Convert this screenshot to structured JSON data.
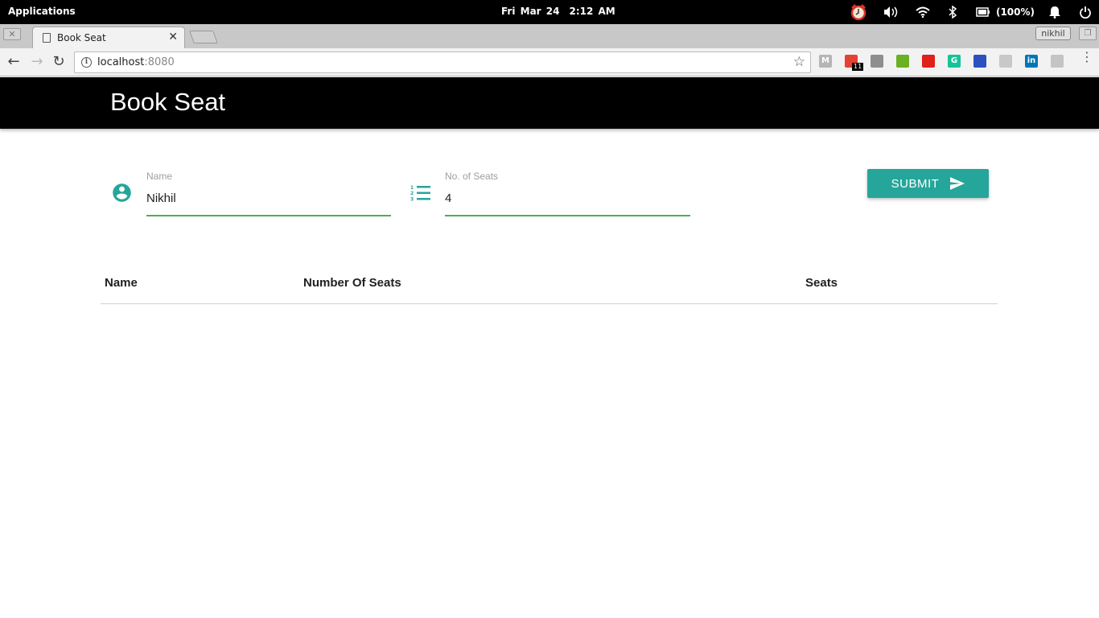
{
  "os": {
    "apps_label": "Applications",
    "date": "Fri Mar 24",
    "time": "2:12 AM",
    "battery_text": "(100%)",
    "tray_icons": [
      "alarm-clock-icon",
      "volume-icon",
      "wifi-icon",
      "bluetooth-icon",
      "battery-icon",
      "notification-bell-icon",
      "power-icon"
    ]
  },
  "browser": {
    "tab_title": "Book Seat",
    "profile_name": "nikhil",
    "url_host": "localhost",
    "url_port": ":8080",
    "extensions": [
      {
        "name": "gmail-ext-icon",
        "label": "M",
        "color": "#b5b5b5"
      },
      {
        "name": "todoist-ext-icon",
        "label": "",
        "color": "#e44332",
        "badge": "11"
      },
      {
        "name": "screenshot-ext-icon",
        "label": "",
        "color": "#8e8e8e"
      },
      {
        "name": "download-ext-icon",
        "label": "",
        "color": "#6ab023"
      },
      {
        "name": "adblock-ext-icon",
        "label": "",
        "color": "#e0201a"
      },
      {
        "name": "grammarly-ext-icon",
        "label": "G",
        "color": "#15c39a"
      },
      {
        "name": "bookmark-ext-icon",
        "label": "",
        "color": "#2d4fbf"
      },
      {
        "name": "mail-tracker-ext-icon",
        "label": "",
        "color": "#c8c8c8"
      },
      {
        "name": "linkedin-ext-icon",
        "label": "in",
        "color": "#0077b5"
      },
      {
        "name": "analytics-ext-icon",
        "label": "",
        "color": "#c4c4c4"
      }
    ]
  },
  "app": {
    "title": "Book Seat",
    "accent_color": "#26a69a",
    "input_underline_color": "#4caf50",
    "form": {
      "name_label": "Name",
      "name_value": "Nikhil",
      "seats_label": "No. of Seats",
      "seats_value": "4",
      "submit_label": "SUBMIT"
    },
    "table": {
      "columns": [
        "Name",
        "Number Of Seats",
        "Seats"
      ],
      "rows": []
    }
  }
}
